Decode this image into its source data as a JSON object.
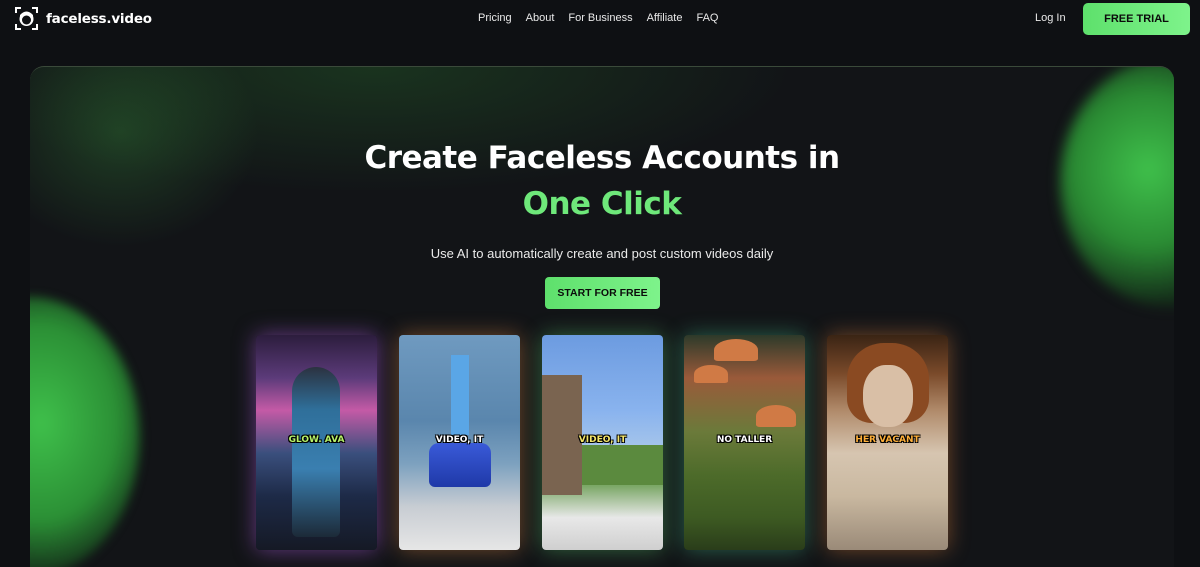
{
  "brand": {
    "name": "faceless.video"
  },
  "nav": {
    "links": [
      "Pricing",
      "About",
      "For Business",
      "Affiliate",
      "FAQ"
    ],
    "login": "Log In",
    "cta": "FREE TRIAL"
  },
  "hero": {
    "title_line1": "Create Faceless Accounts in",
    "title_line2": "One Click",
    "subtitle": "Use AI to automatically create and post custom videos daily",
    "cta": "START FOR FREE"
  },
  "cards": [
    {
      "caption": "GLOW. AVA",
      "caption_color": "#b7f36a"
    },
    {
      "caption": "VIDEO, IT",
      "caption_color": "#ffffff"
    },
    {
      "caption": "VIDEO, IT",
      "caption_color": "#f5e66a"
    },
    {
      "caption": "NO TALLER",
      "caption_color": "#ffffff"
    },
    {
      "caption": "HER VACANT",
      "caption_color": "#ffb03a"
    }
  ],
  "colors": {
    "accent": "#6ee87a",
    "background": "#0e1013",
    "button_text": "#0b0b0b"
  }
}
